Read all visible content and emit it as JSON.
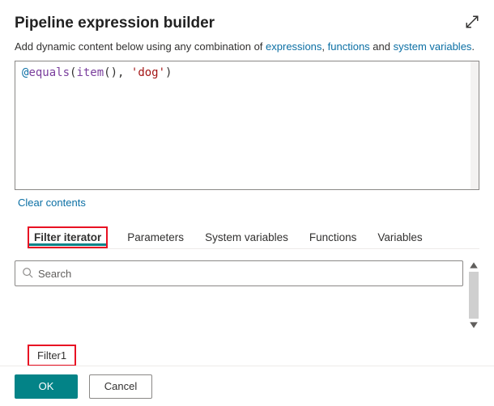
{
  "header": {
    "title": "Pipeline expression builder"
  },
  "hint": {
    "prefix": "Add dynamic content below using any combination of ",
    "link_expressions": "expressions",
    "sep1": ", ",
    "link_functions": "functions",
    "sep2": " and ",
    "link_sysvars": "system variables",
    "suffix": "."
  },
  "editor": {
    "at": "@",
    "fn1": "equals",
    "paren1": "(",
    "fn2": "item",
    "paren2": "()",
    "comma": ", ",
    "str": "'dog'",
    "close": ")"
  },
  "actions": {
    "clear": "Clear contents"
  },
  "tabs": {
    "items": [
      {
        "label": "Filter iterator",
        "active": true,
        "highlight": true
      },
      {
        "label": "Parameters"
      },
      {
        "label": "System variables"
      },
      {
        "label": "Functions"
      },
      {
        "label": "Variables"
      }
    ]
  },
  "search": {
    "placeholder": "Search"
  },
  "results": {
    "item1": "Filter1"
  },
  "footer": {
    "ok": "OK",
    "cancel": "Cancel"
  }
}
